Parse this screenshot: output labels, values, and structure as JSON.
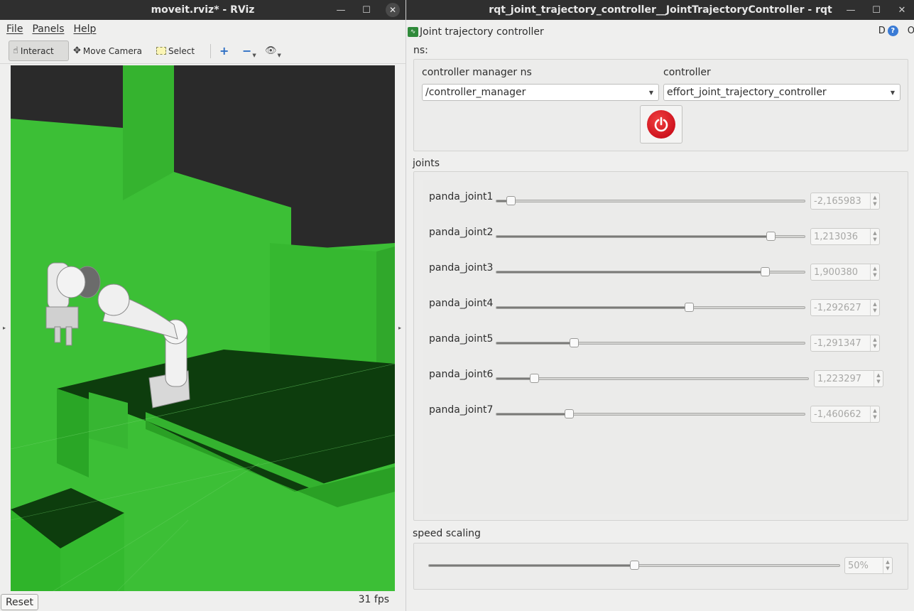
{
  "rviz": {
    "title": "moveit.rviz* - RViz",
    "menu": [
      "File",
      "Panels",
      "Help"
    ],
    "tools": {
      "interact": "Interact",
      "move_camera": "Move Camera",
      "select": "Select"
    },
    "reset_label": "Reset",
    "fps": "31 fps",
    "viewport_colors": {
      "floor": "#3cbf36",
      "shadow": "#0b3b0b",
      "background": "#2a2a2a"
    }
  },
  "rqt": {
    "title": "rqt_joint_trajectory_controller__JointTrajectoryController - rqt",
    "plugin_title": "Joint trajectory controller",
    "header_right": {
      "d_label": "D",
      "o_label": "O"
    },
    "ns_label": "ns:",
    "controller_manager_label": "controller manager ns",
    "controller_manager_value": "/controller_manager",
    "controller_label": "controller",
    "controller_value": "effort_joint_trajectory_controller",
    "power_button_color": "#d4001a",
    "joints_label": "joints",
    "joints": [
      {
        "name": "panda_joint1",
        "value": "-2,165983",
        "fraction": 0.045
      },
      {
        "name": "panda_joint2",
        "value": "1,213036",
        "fraction": 0.89
      },
      {
        "name": "panda_joint3",
        "value": "1,900380",
        "fraction": 0.87
      },
      {
        "name": "panda_joint4",
        "value": "-1,292627",
        "fraction": 0.625
      },
      {
        "name": "panda_joint5",
        "value": "-1,291347",
        "fraction": 0.25
      },
      {
        "name": "panda_joint6",
        "value": "1,223297",
        "fraction": 0.12
      },
      {
        "name": "panda_joint7",
        "value": "-1,460662",
        "fraction": 0.235
      }
    ],
    "speed_scaling_label": "speed scaling",
    "speed_scaling_value": "50%",
    "speed_scaling_fraction": 0.5
  }
}
